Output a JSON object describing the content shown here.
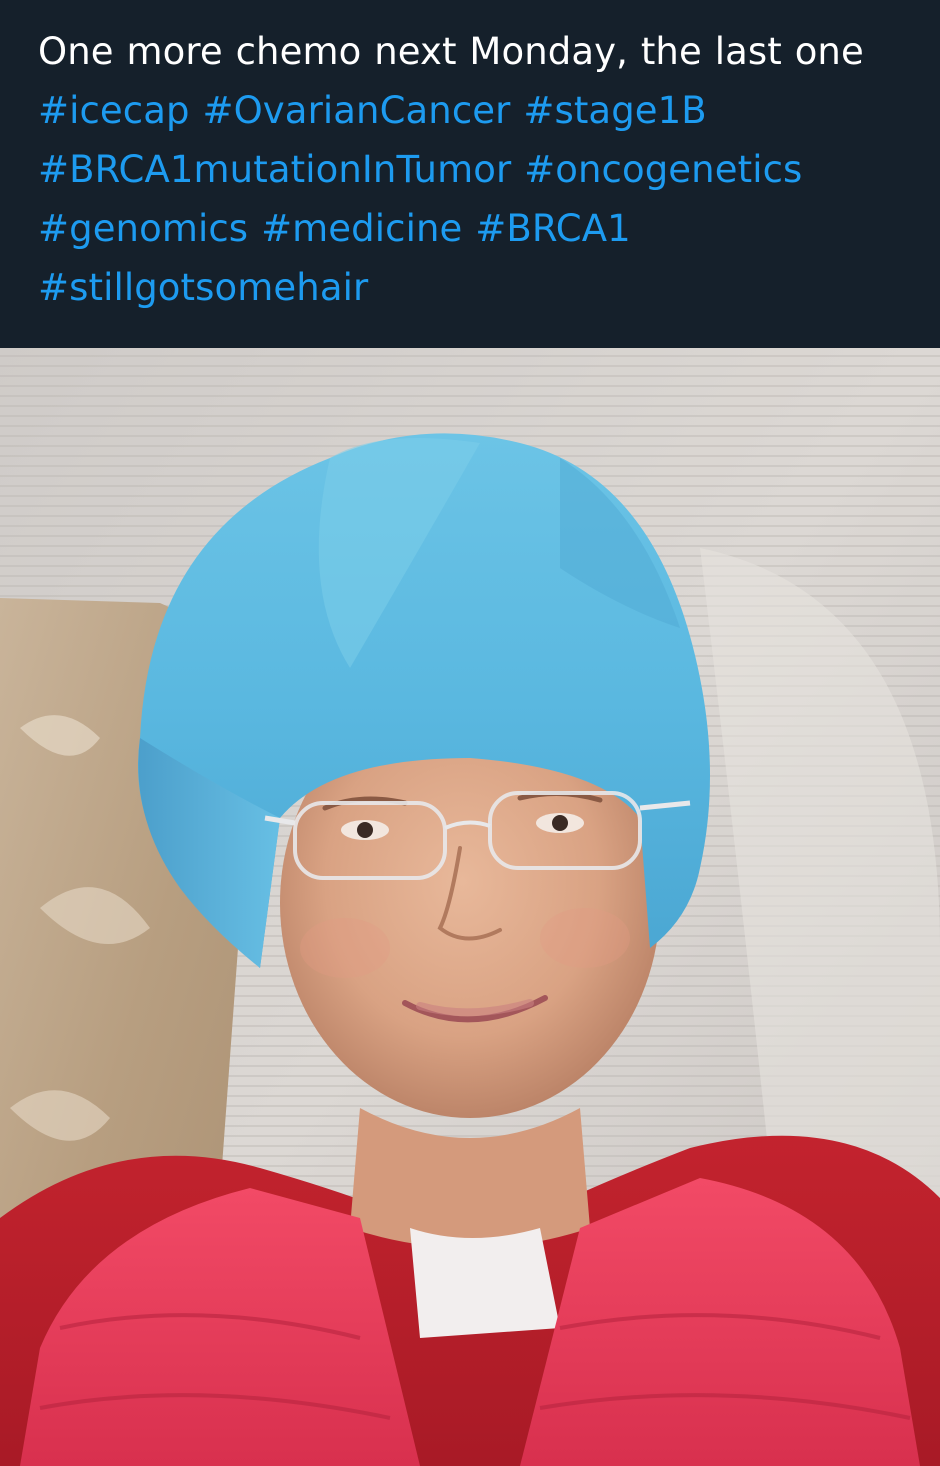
{
  "tweet": {
    "text_plain_1": "One more chemo next Monday, the last one",
    "hashtags": [
      "#icecap",
      "#OvarianCancer",
      "#stage1B",
      "#BRCA1mutationInTumor",
      "#oncogenetics",
      "#genomics",
      "#medicine",
      "#BRCA1",
      "#stillgotsomehair"
    ]
  },
  "theme": {
    "background": "#15202b",
    "text_color": "#ffffff",
    "hashtag_color": "#1d9bf0"
  },
  "media": {
    "type": "photo"
  }
}
